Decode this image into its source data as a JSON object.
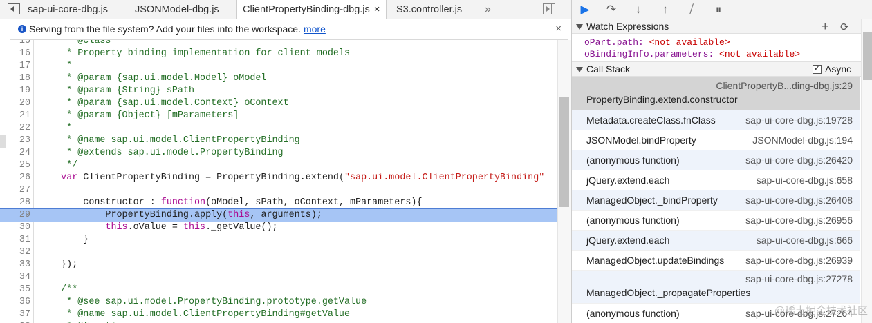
{
  "tabs": [
    {
      "label": "sap-ui-core-dbg.js",
      "active": false
    },
    {
      "label": "JSONModel-dbg.js",
      "active": false
    },
    {
      "label": "ClientPropertyBinding-dbg.js",
      "active": true
    },
    {
      "label": "S3.controller.js",
      "active": false
    }
  ],
  "tab_overflow": "»",
  "tab_close": "×",
  "infobar": {
    "icon": "i",
    "text": "Serving from the file system? Add your files into the workspace.",
    "link": "more",
    "close": "×"
  },
  "code": {
    "highlight_line": 29,
    "lines": [
      {
        "n": "15",
        "tokens": [
          [
            "c",
            "     * @class"
          ]
        ]
      },
      {
        "n": "16",
        "tokens": [
          [
            "c",
            "     * Property binding implementation for client models"
          ]
        ]
      },
      {
        "n": "17",
        "tokens": [
          [
            "c",
            "     *"
          ]
        ]
      },
      {
        "n": "18",
        "tokens": [
          [
            "c",
            "     * @param {sap.ui.model.Model} oModel"
          ]
        ]
      },
      {
        "n": "19",
        "tokens": [
          [
            "c",
            "     * @param {String} sPath"
          ]
        ]
      },
      {
        "n": "20",
        "tokens": [
          [
            "c",
            "     * @param {sap.ui.model.Context} oContext"
          ]
        ]
      },
      {
        "n": "21",
        "tokens": [
          [
            "c",
            "     * @param {Object} [mParameters]"
          ]
        ]
      },
      {
        "n": "22",
        "tokens": [
          [
            "c",
            "     *"
          ]
        ]
      },
      {
        "n": "23",
        "tokens": [
          [
            "c",
            "     * @name sap.ui.model.ClientPropertyBinding"
          ]
        ]
      },
      {
        "n": "24",
        "tokens": [
          [
            "c",
            "     * @extends sap.ui.model.PropertyBinding"
          ]
        ]
      },
      {
        "n": "25",
        "tokens": [
          [
            "c",
            "     */"
          ]
        ]
      },
      {
        "n": "26",
        "tokens": [
          [
            "p",
            "    "
          ],
          [
            "k",
            "var"
          ],
          [
            "p",
            " ClientPropertyBinding = PropertyBinding.extend("
          ],
          [
            "s",
            "\"sap.ui.model.ClientPropertyBinding\""
          ],
          [
            "p",
            " "
          ]
        ]
      },
      {
        "n": "27",
        "tokens": [
          [
            "p",
            ""
          ]
        ]
      },
      {
        "n": "28",
        "tokens": [
          [
            "p",
            "        constructor : "
          ],
          [
            "k",
            "function"
          ],
          [
            "p",
            "(oModel, sPath, oContext, mParameters){"
          ]
        ]
      },
      {
        "n": "29",
        "tokens": [
          [
            "p",
            "            PropertyBinding.apply("
          ],
          [
            "k",
            "this"
          ],
          [
            "p",
            ", arguments);"
          ]
        ]
      },
      {
        "n": "30",
        "tokens": [
          [
            "p",
            "            "
          ],
          [
            "k",
            "this"
          ],
          [
            "p",
            ".oValue = "
          ],
          [
            "k",
            "this"
          ],
          [
            "p",
            "._getValue();"
          ]
        ]
      },
      {
        "n": "31",
        "tokens": [
          [
            "p",
            "        }"
          ]
        ]
      },
      {
        "n": "32",
        "tokens": [
          [
            "p",
            ""
          ]
        ]
      },
      {
        "n": "33",
        "tokens": [
          [
            "p",
            "    });"
          ]
        ]
      },
      {
        "n": "34",
        "tokens": [
          [
            "p",
            ""
          ]
        ]
      },
      {
        "n": "35",
        "tokens": [
          [
            "c",
            "    /**"
          ]
        ]
      },
      {
        "n": "36",
        "tokens": [
          [
            "c",
            "     * @see sap.ui.model.PropertyBinding.prototype.getValue"
          ]
        ]
      },
      {
        "n": "37",
        "tokens": [
          [
            "c",
            "     * @name sap.ui.model.ClientPropertyBinding#getValue"
          ]
        ]
      },
      {
        "n": "38",
        "tokens": [
          [
            "c",
            "     * @function"
          ]
        ]
      }
    ]
  },
  "debugger_toolbar": [
    {
      "name": "resume-icon",
      "glyph": "▶"
    },
    {
      "name": "step-over-icon",
      "glyph": "↷"
    },
    {
      "name": "step-into-icon",
      "glyph": "↓"
    },
    {
      "name": "step-out-icon",
      "glyph": "↑"
    },
    {
      "name": "deactivate-breakpoints-icon",
      "glyph": "⧸"
    },
    {
      "name": "pause-on-exceptions-icon",
      "glyph": "⏸"
    }
  ],
  "watch": {
    "title": "Watch Expressions",
    "add_glyph": "+",
    "refresh_glyph": "⟳",
    "items": [
      {
        "name": "oPart.path",
        "value": "<not available>"
      },
      {
        "name": "oBindingInfo.parameters",
        "value": "<not available>"
      }
    ]
  },
  "callstack": {
    "title": "Call Stack",
    "async_label": "Async",
    "async_checked": true,
    "check_glyph": "✓",
    "frames": [
      {
        "name": "PropertyBinding.extend.constructor",
        "location": "ClientPropertyB...ding-dbg.js:29",
        "selected": true
      },
      {
        "name": "Metadata.createClass.fnClass",
        "location": "sap-ui-core-dbg.js:19728"
      },
      {
        "name": "JSONModel.bindProperty",
        "location": "JSONModel-dbg.js:194"
      },
      {
        "name": "(anonymous function)",
        "location": "sap-ui-core-dbg.js:26420"
      },
      {
        "name": "jQuery.extend.each",
        "location": "sap-ui-core-dbg.js:658"
      },
      {
        "name": "ManagedObject._bindProperty",
        "location": "sap-ui-core-dbg.js:26408"
      },
      {
        "name": "(anonymous function)",
        "location": "sap-ui-core-dbg.js:26956"
      },
      {
        "name": "jQuery.extend.each",
        "location": "sap-ui-core-dbg.js:666"
      },
      {
        "name": "ManagedObject.updateBindings",
        "location": "sap-ui-core-dbg.js:26939"
      },
      {
        "name": "ManagedObject._propagateProperties",
        "location": "sap-ui-core-dbg.js:27278",
        "two_line": true
      },
      {
        "name": "(anonymous function)",
        "location": "sap-ui-core-dbg.js:27264"
      }
    ]
  },
  "watermark": "@稀土掘金技术社区"
}
